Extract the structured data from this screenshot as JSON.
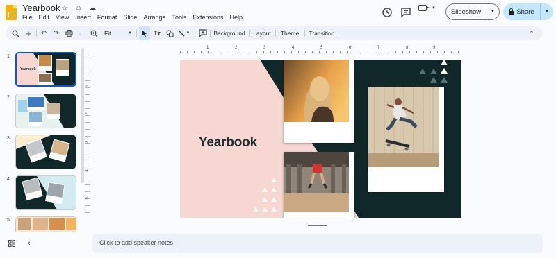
{
  "app": {
    "doc_title": "Yearbook",
    "menu": [
      "File",
      "Edit",
      "View",
      "Insert",
      "Format",
      "Slide",
      "Arrange",
      "Tools",
      "Extensions",
      "Help"
    ]
  },
  "header": {
    "slideshow_label": "Slideshow",
    "share_label": "Share"
  },
  "toolbar": {
    "zoom_label": "Fit",
    "background_label": "Background",
    "layout_label": "Layout",
    "theme_label": "Theme",
    "transition_label": "Transition"
  },
  "filmstrip": {
    "slides": [
      {
        "number": "1",
        "thumb_title": "Yearbook"
      },
      {
        "number": "2"
      },
      {
        "number": "3"
      },
      {
        "number": "4"
      },
      {
        "number": "5"
      }
    ]
  },
  "ruler": {
    "numbers": [
      "1",
      "2",
      "3",
      "4",
      "5",
      "6",
      "7",
      "8",
      "9"
    ],
    "vnumbers": [
      "1",
      "2",
      "3",
      "4",
      "5"
    ]
  },
  "slide": {
    "title": "Yearbook"
  },
  "notes": {
    "placeholder": "Click to add speaker notes"
  },
  "colors": {
    "accent": "#0b57d0",
    "share_bg": "#c2e7ff",
    "slide_pink": "#f7d7d2",
    "slide_dark": "#11282b"
  },
  "icons": [
    "star-icon",
    "move-to-folder-icon",
    "cloud-status-icon",
    "history-icon",
    "comment-icon",
    "meet-icon",
    "lock-icon",
    "search-icon",
    "zoom-in-icon",
    "undo-icon",
    "redo-icon",
    "print-icon",
    "paint-format-icon",
    "zoom-icon",
    "select-icon",
    "textbox-icon",
    "shape-icon",
    "line-icon",
    "add-comment-icon",
    "collapse-icon",
    "grid-view-icon",
    "hide-panel-icon"
  ]
}
